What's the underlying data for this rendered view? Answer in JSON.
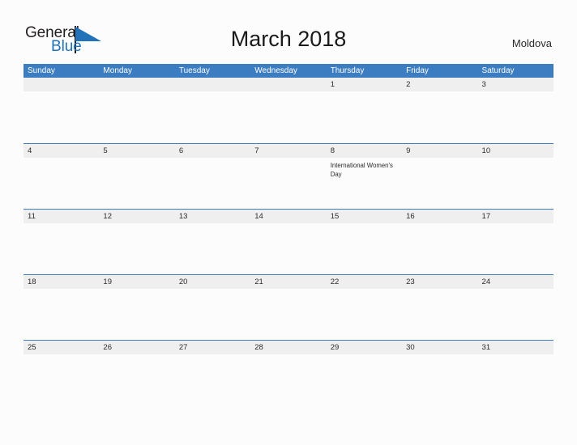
{
  "brand": {
    "name_part1": "General",
    "name_part2": "Blue",
    "logo_icon": "triangle-flag-icon",
    "color_dark": "#231f20",
    "color_blue": "#2272b9"
  },
  "header": {
    "title": "March 2018",
    "country": "Moldova"
  },
  "theme": {
    "header_blue": "#3b7dc0",
    "band_gray": "#efefef",
    "page_background": "#fcfcfd",
    "text_dark": "#2b2b2b"
  },
  "calendar": {
    "weekdays": [
      "Sunday",
      "Monday",
      "Tuesday",
      "Wednesday",
      "Thursday",
      "Friday",
      "Saturday"
    ],
    "weeks": [
      [
        {
          "day": ""
        },
        {
          "day": ""
        },
        {
          "day": ""
        },
        {
          "day": ""
        },
        {
          "day": "1"
        },
        {
          "day": "2"
        },
        {
          "day": "3"
        }
      ],
      [
        {
          "day": "4"
        },
        {
          "day": "5"
        },
        {
          "day": "6"
        },
        {
          "day": "7"
        },
        {
          "day": "8",
          "event": "International Women's Day"
        },
        {
          "day": "9"
        },
        {
          "day": "10"
        }
      ],
      [
        {
          "day": "11"
        },
        {
          "day": "12"
        },
        {
          "day": "13"
        },
        {
          "day": "14"
        },
        {
          "day": "15"
        },
        {
          "day": "16"
        },
        {
          "day": "17"
        }
      ],
      [
        {
          "day": "18"
        },
        {
          "day": "19"
        },
        {
          "day": "20"
        },
        {
          "day": "21"
        },
        {
          "day": "22"
        },
        {
          "day": "23"
        },
        {
          "day": "24"
        }
      ],
      [
        {
          "day": "25"
        },
        {
          "day": "26"
        },
        {
          "day": "27"
        },
        {
          "day": "28"
        },
        {
          "day": "29"
        },
        {
          "day": "30"
        },
        {
          "day": "31"
        }
      ]
    ]
  }
}
